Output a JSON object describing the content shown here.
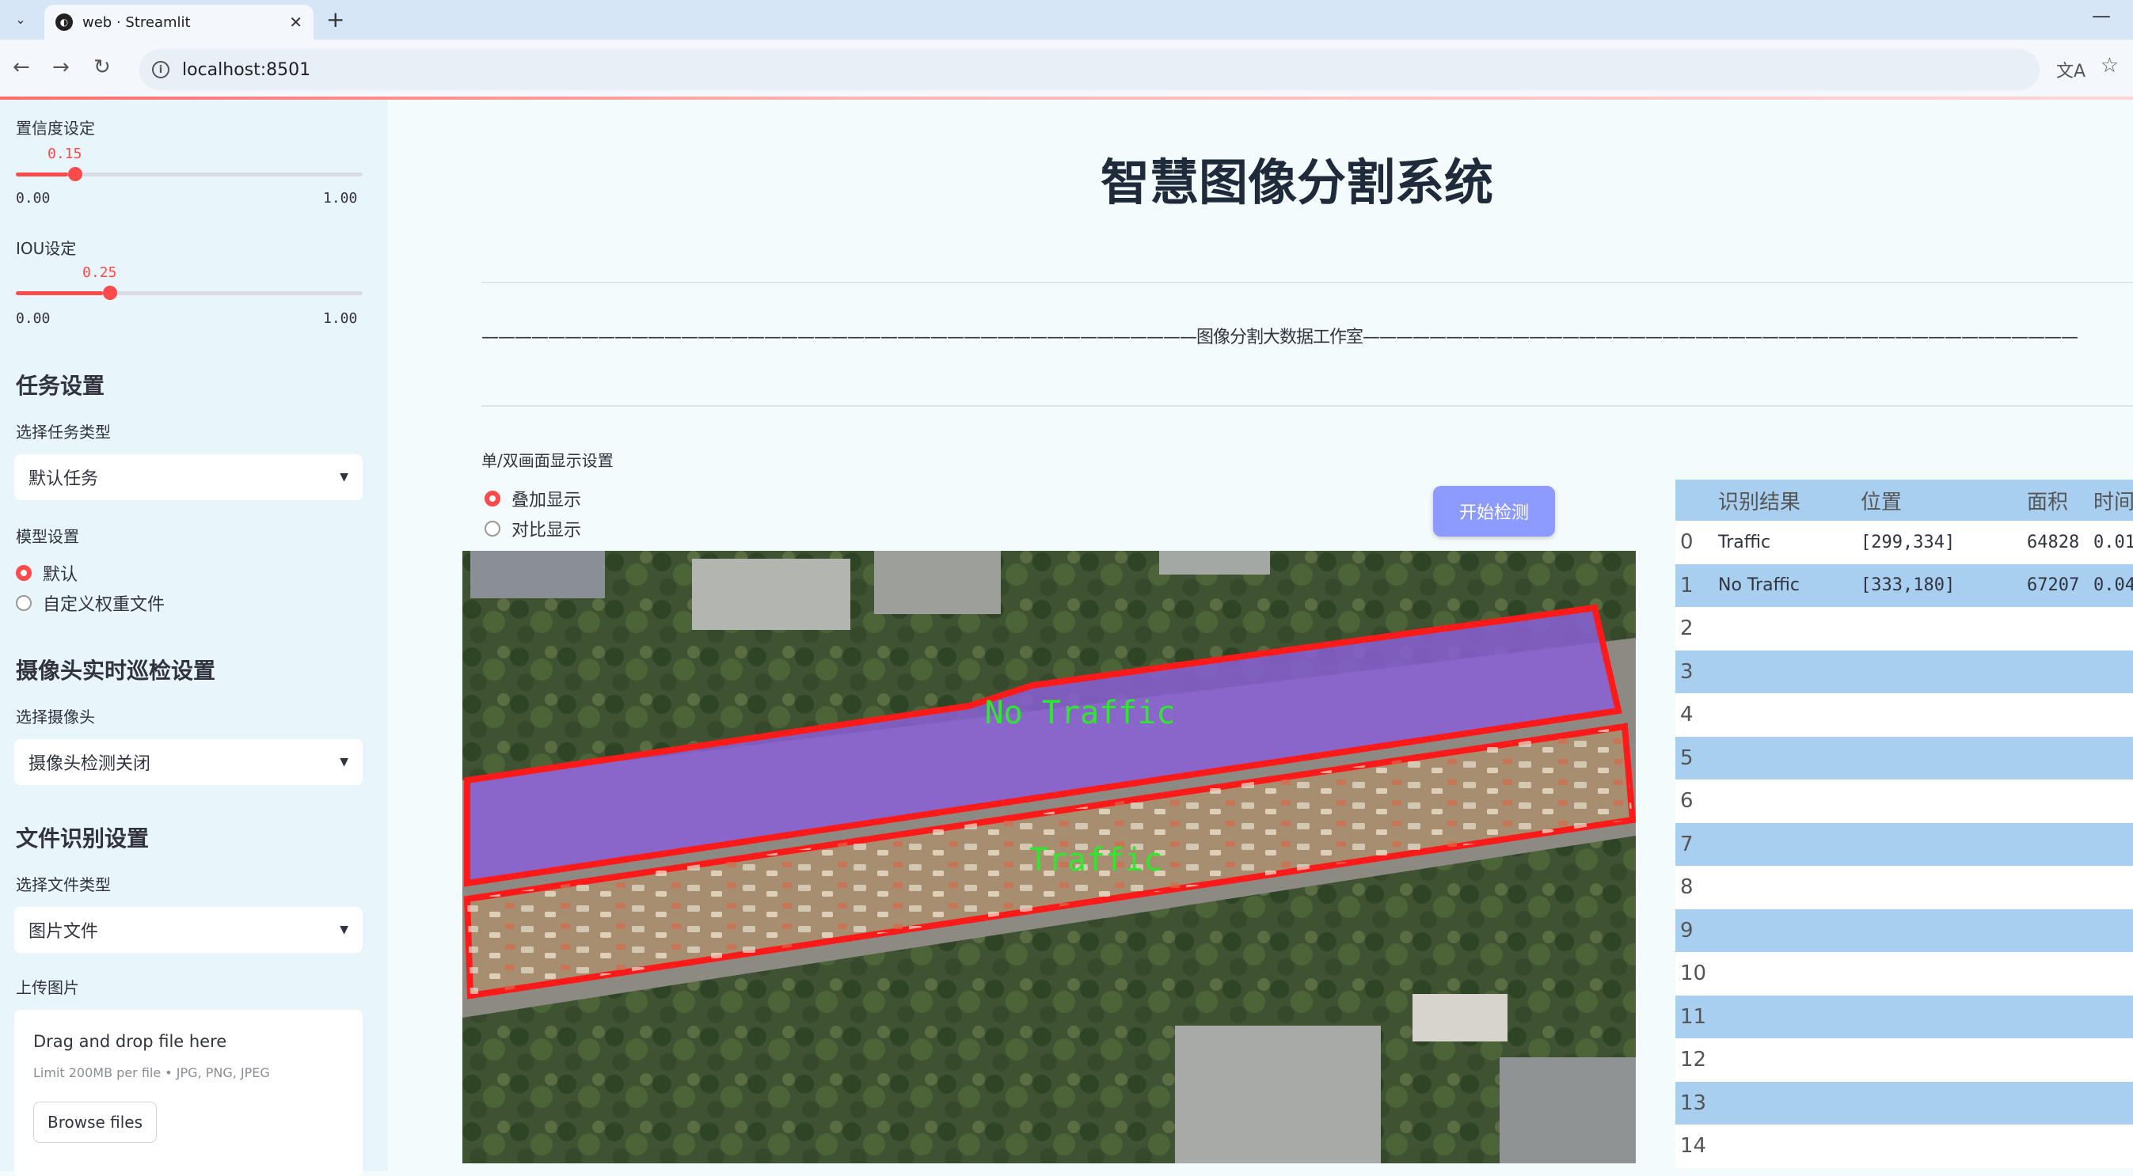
{
  "browser": {
    "tab_title": "web · Streamlit",
    "url": "localhost:8501",
    "menu_icon": "chevron-down-icon",
    "new_tab": "+",
    "minimize": "—"
  },
  "sidebar": {
    "conf_label": "置信度设定",
    "conf_value": "0.15",
    "conf_min": "0.00",
    "conf_max": "1.00",
    "conf_fraction": 0.15,
    "iou_label": "IOU设定",
    "iou_value": "0.25",
    "iou_min": "0.00",
    "iou_max": "1.00",
    "iou_fraction": 0.25,
    "task_header": "任务设置",
    "task_type_label": "选择任务类型",
    "task_type_value": "默认任务",
    "model_label": "模型设置",
    "model_options": [
      "默认",
      "自定义权重文件"
    ],
    "camera_header": "摄像头实时巡检设置",
    "camera_label": "选择摄像头",
    "camera_value": "摄像头检测关闭",
    "file_header": "文件识别设置",
    "file_type_label": "选择文件类型",
    "file_type_value": "图片文件",
    "upload_label": "上传图片",
    "upload_title": "Drag and drop file here",
    "upload_hint": "Limit 200MB per file • JPG, PNG, JPEG",
    "browse_label": "Browse files"
  },
  "main": {
    "title": "智慧图像分割系统",
    "subtitle_line": "———————————————————————————————————————————图像分割大数据工作室———————————————————————————————————————————",
    "mode_label": "单/双画面显示设置",
    "mode_options": [
      "叠加显示",
      "对比显示"
    ],
    "start_button": "开始检测",
    "overlay_labels": [
      "No Traffic",
      "Traffic"
    ]
  },
  "table": {
    "columns": [
      "",
      "识别结果",
      "位置",
      "面积",
      "时间"
    ],
    "rows": [
      {
        "idx": "0",
        "result": "Traffic",
        "pos": "[299,334]",
        "area": "64828",
        "time": "0.01"
      },
      {
        "idx": "1",
        "result": "No Traffic",
        "pos": "[333,180]",
        "area": "67207",
        "time": "0.04"
      },
      {
        "idx": "2",
        "result": "",
        "pos": "",
        "area": "",
        "time": ""
      },
      {
        "idx": "3",
        "result": "",
        "pos": "",
        "area": "",
        "time": ""
      },
      {
        "idx": "4",
        "result": "",
        "pos": "",
        "area": "",
        "time": ""
      },
      {
        "idx": "5",
        "result": "",
        "pos": "",
        "area": "",
        "time": ""
      },
      {
        "idx": "6",
        "result": "",
        "pos": "",
        "area": "",
        "time": ""
      },
      {
        "idx": "7",
        "result": "",
        "pos": "",
        "area": "",
        "time": ""
      },
      {
        "idx": "8",
        "result": "",
        "pos": "",
        "area": "",
        "time": ""
      },
      {
        "idx": "9",
        "result": "",
        "pos": "",
        "area": "",
        "time": ""
      },
      {
        "idx": "10",
        "result": "",
        "pos": "",
        "area": "",
        "time": ""
      },
      {
        "idx": "11",
        "result": "",
        "pos": "",
        "area": "",
        "time": ""
      },
      {
        "idx": "12",
        "result": "",
        "pos": "",
        "area": "",
        "time": ""
      },
      {
        "idx": "13",
        "result": "",
        "pos": "",
        "area": "",
        "time": ""
      },
      {
        "idx": "14",
        "result": "",
        "pos": "",
        "area": "",
        "time": ""
      }
    ]
  },
  "colors": {
    "accent": "#ff4b4b",
    "button": "#8c9bfd",
    "table_stripe": "#a8cff0",
    "segment_border": "#ff0000",
    "no_traffic_fill": "#8a5fd6",
    "label_text": "#2ee82e"
  }
}
